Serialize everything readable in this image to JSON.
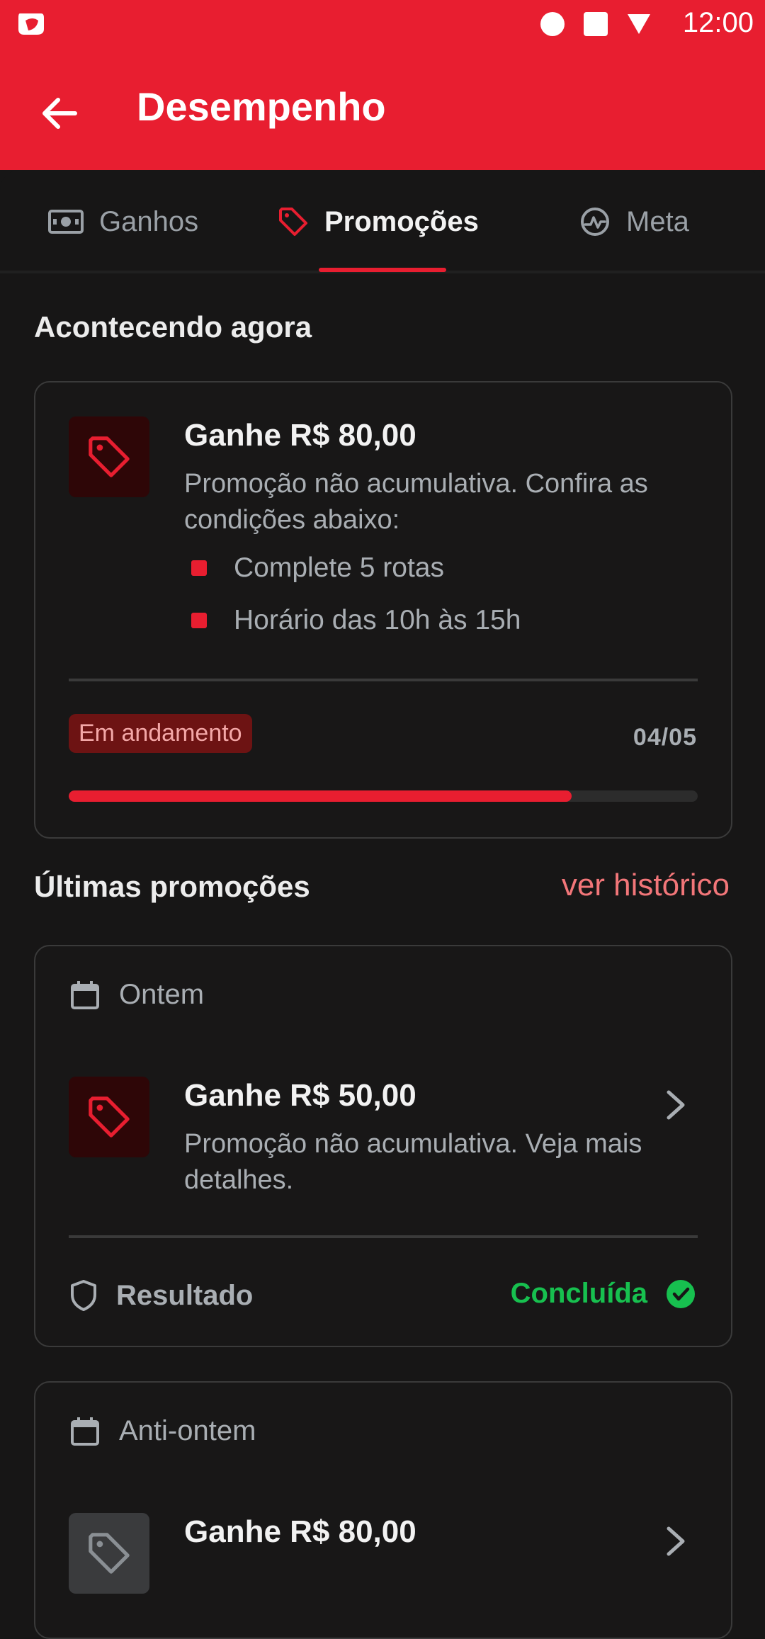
{
  "status_bar": {
    "time": "12:00"
  },
  "header": {
    "title": "Desempenho"
  },
  "tabs": [
    {
      "label": "Ganhos",
      "icon": "money-icon"
    },
    {
      "label": "Promoções",
      "icon": "tag-icon",
      "active": true
    },
    {
      "label": "Meta",
      "icon": "gauge-icon"
    }
  ],
  "current": {
    "section_title": "Acontecendo agora",
    "promo": {
      "title": "Ganhe R$ 80,00",
      "description": "Promoção não acumulativa. Confira as condições abaixo:",
      "conditions": [
        "Complete 5 rotas",
        "Horário das 10h às 15h"
      ],
      "status": "Em andamento",
      "progress_text": "04/05",
      "progress_fraction": 0.8
    }
  },
  "history": {
    "section_title": "Últimas promoções",
    "link_label": "ver histórico",
    "items": [
      {
        "date_label": "Ontem",
        "title": "Ganhe R$ 50,00",
        "description": "Promoção não acumulativa. Veja mais detalhes.",
        "result_label": "Resultado",
        "result_status": "Concluída"
      },
      {
        "date_label": "Anti-ontem",
        "title": "Ganhe R$ 80,00"
      }
    ]
  },
  "colors": {
    "brand_red": "#e81e30",
    "success_green": "#17c04f",
    "link_pink": "#f27679"
  }
}
